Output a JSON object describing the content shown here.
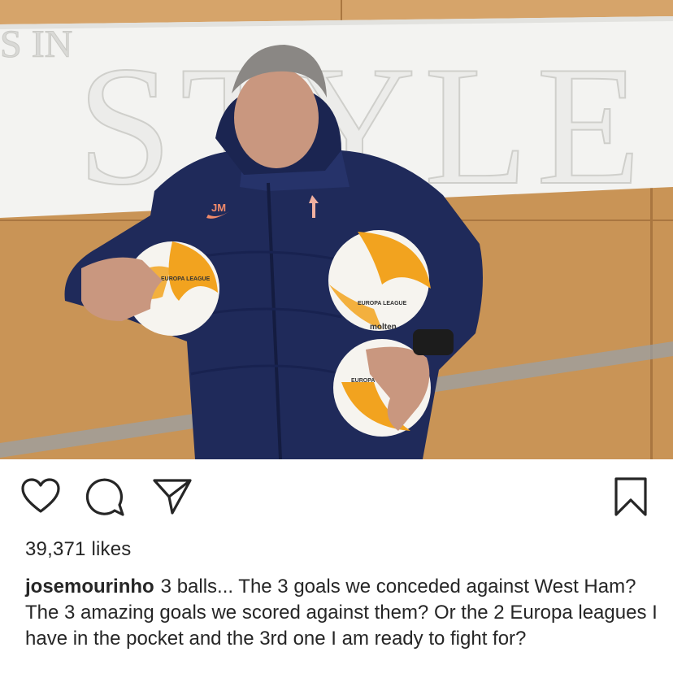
{
  "post": {
    "image_alt": "Man in navy padded jacket holding three Europa League match balls against a wall with 'IN STYLE' lettering",
    "wall_text_left": "S IN",
    "wall_text_main": "STYLE",
    "jacket_initials": "JM",
    "ball_labels": [
      "EUROPA LEAGUE",
      "EUROPA LEAGUE",
      "EUROPA LEAGUE"
    ],
    "ball_brand": "molten"
  },
  "actions": {
    "like_icon": "heart-icon",
    "comment_icon": "comment-icon",
    "share_icon": "paper-plane-icon",
    "save_icon": "bookmark-icon"
  },
  "likes_text": "39,371 likes",
  "caption": {
    "username": "josemourinho",
    "text": "3 balls... The 3 goals we conceded against West Ham? The 3 amazing goals we scored against them? Or the 2 Europa leagues I have in the pocket and the 3rd one I am ready to fight for?"
  },
  "colors": {
    "wood": "#c8914f",
    "wall_panel": "#f4f4f2",
    "jacket": "#1f2a5a",
    "ball_orange": "#f0a020",
    "text": "#262626"
  }
}
